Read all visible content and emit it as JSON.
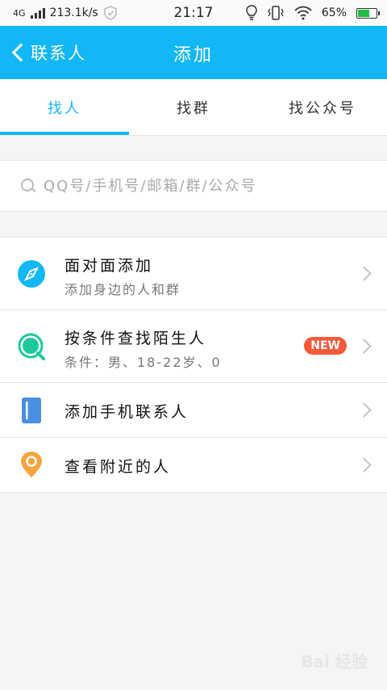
{
  "status_bar": {
    "network": "4G",
    "speed": "213.1k/s",
    "time": "21:17",
    "battery": "65%",
    "battery_level": 0.65
  },
  "header": {
    "back_label": "联系人",
    "title": "添加"
  },
  "tabs": [
    {
      "label": "找人",
      "active": true
    },
    {
      "label": "找群",
      "active": false
    },
    {
      "label": "找公众号",
      "active": false
    }
  ],
  "search": {
    "placeholder": "QQ号/手机号/邮箱/群/公众号"
  },
  "list": [
    {
      "title": "面对面添加",
      "subtitle": "添加身边的人和群",
      "icon": "compass-icon"
    },
    {
      "title": "按条件查找陌生人",
      "subtitle": "条件：男、18-22岁、0",
      "badge": "NEW",
      "icon": "search-circle-icon"
    },
    {
      "title": "添加手机联系人",
      "icon": "phonebook-icon"
    },
    {
      "title": "查看附近的人",
      "icon": "location-pin-icon"
    }
  ],
  "watermark": "Bai 经验",
  "colors": {
    "accent": "#12b7f5",
    "badge": "#f25a3a",
    "green": "#1dc99a",
    "orange": "#f7a440",
    "blue_book": "#4a90e2"
  }
}
